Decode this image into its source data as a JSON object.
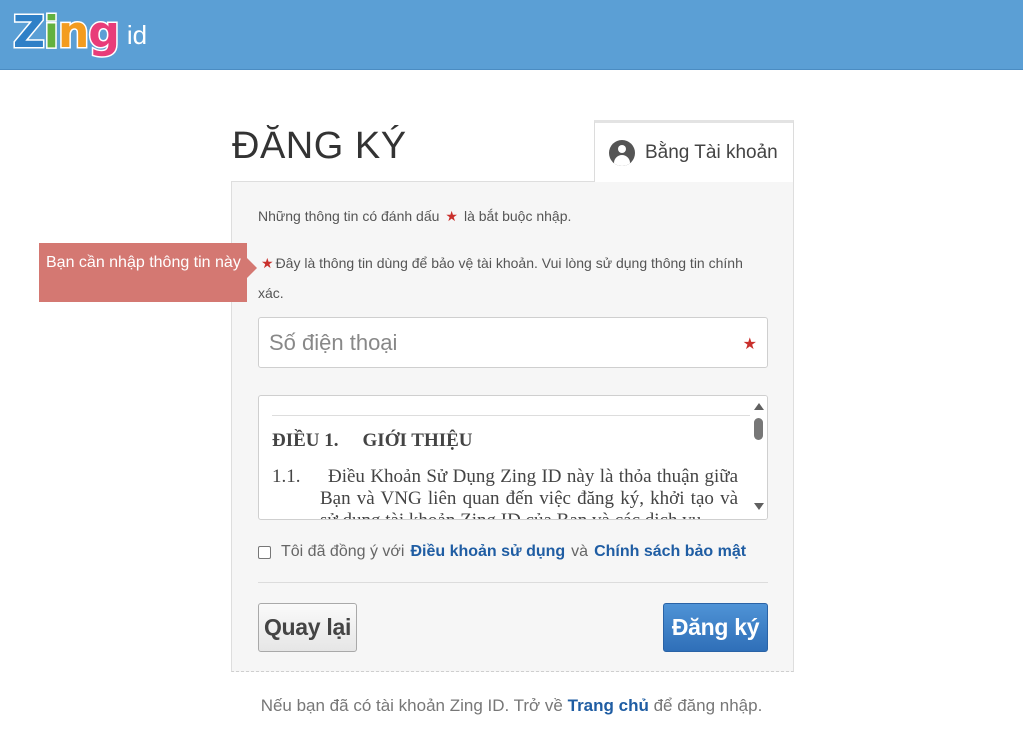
{
  "header": {
    "logo_text": [
      "Z",
      "i",
      "n",
      "g"
    ],
    "logo_suffix": "id",
    "bg_color": "#5b9fd5"
  },
  "form": {
    "title": "ĐĂNG KÝ",
    "tab_label": "Bằng Tài khoản",
    "tab_icon": "user-circle-icon",
    "required_note_before": "Những thông tin có đánh dấu",
    "required_note_after": "là bắt buộc nhập.",
    "required_mark": "★",
    "info_note": "Đây là thông tin dùng để bảo vệ tài khoản. Vui lòng sử dụng thông tin chính xác.",
    "phone_placeholder": "Số điện thoại",
    "terms": {
      "heading_num": "ĐIỀU 1.",
      "heading_title": "GIỚI THIỆU",
      "para_num": "1.1.",
      "para_text": "Điều Khoản Sử Dụng Zing ID này là thỏa thuận giữa Bạn và VNG liên quan đến việc đăng ký, khởi tạo và sử dụng tài khoản Zing ID của Bạn và các dịch vụ"
    },
    "agree_prefix": "Tôi đã đồng ý với",
    "agree_terms_link": "Điều khoản sử dụng",
    "agree_and": "và",
    "agree_privacy_link": "Chính sách bảo mật",
    "back_button": "Quay lại",
    "submit_button": "Đăng ký"
  },
  "tooltip": {
    "text": "Bạn cần nhập thông tin này",
    "color": "#d47872"
  },
  "footer": {
    "prefix": "Nếu bạn đã có tài khoản Zing ID. Trở về",
    "link": "Trang chủ",
    "suffix": "để đăng nhập."
  },
  "colors": {
    "link": "#1f5da3",
    "required": "#c9302c",
    "primary_button": "#3a7fc6"
  }
}
